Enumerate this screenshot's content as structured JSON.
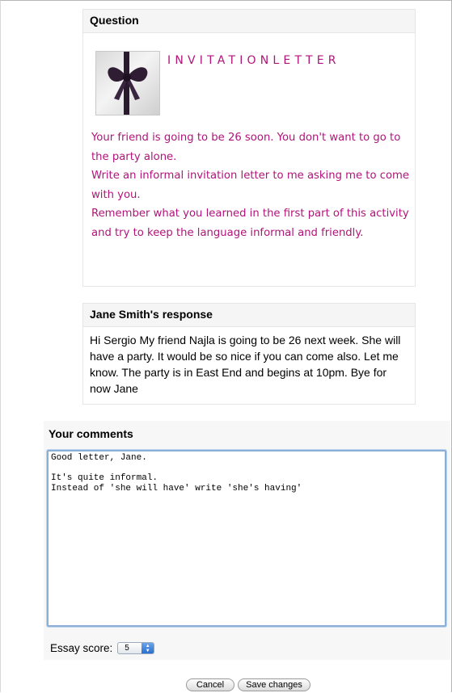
{
  "question": {
    "header": "Question",
    "title": "INVITATIONLETTER",
    "lines": [
      "Your friend is going to be 26 soon. You don't want to go to the party alone.",
      "Write an informal invitation letter to me asking me to come with you.",
      "Remember what you learned in the first part of this activity and try to keep the language informal and friendly."
    ]
  },
  "response": {
    "header": "Jane Smith's response",
    "text": "Hi Sergio My friend Najla is going to be 26 next week. She will have a party. It would be so nice if you can come also. Let me know. The party is in East End and begins at 10pm. Bye for now Jane"
  },
  "comments": {
    "label": "Your comments",
    "value": "Good letter, Jane.\n\nIt's quite informal.\nInstead of 'she will have' write 'she's having'"
  },
  "score": {
    "label": "Essay score:",
    "selected": "5"
  },
  "buttons": {
    "cancel": "Cancel",
    "save": "Save changes"
  },
  "colors": {
    "question_text": "#b0147a",
    "textarea_focus": "#8bb0d8"
  }
}
